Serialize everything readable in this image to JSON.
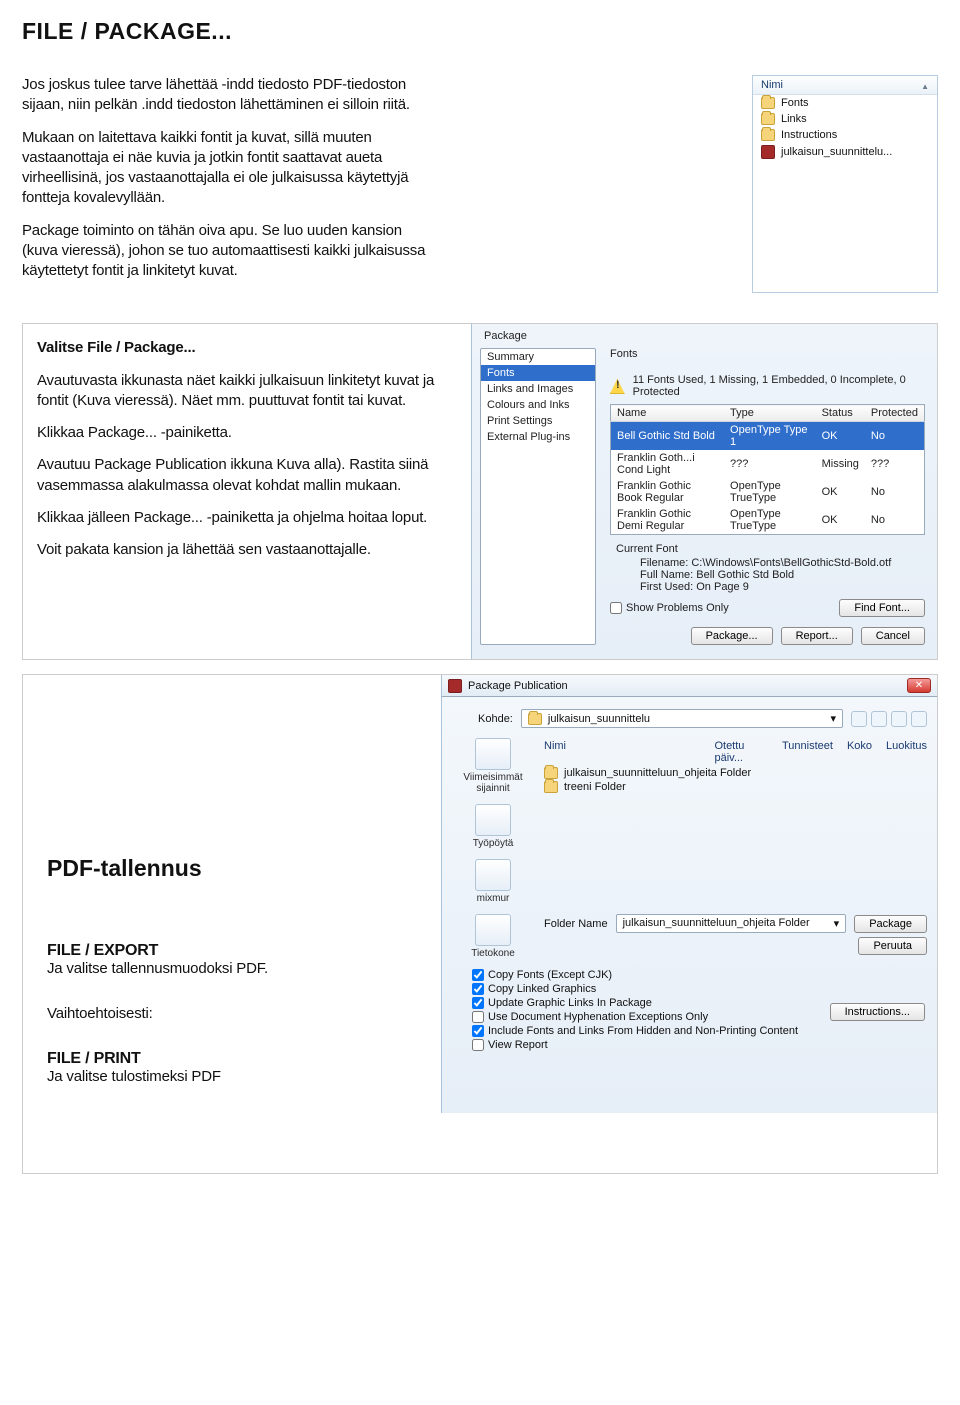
{
  "heading": "FILE / PACKAGE...",
  "intro": {
    "p1": "Jos joskus tulee tarve lähettää -indd tiedosto PDF-tiedoston sijaan, niin pelkän .indd tiedoston lähettäminen ei silloin riitä.",
    "p2": "Mukaan on laitettava kaikki fontit ja kuvat, sillä muuten vastaanottaja ei näe kuvia ja jotkin fontit saattavat aueta virheellisinä, jos vastaanottajalla ei ole julkaisussa käytettyjä fontteja kovalevyllään.",
    "p3": "Package toiminto on tähän oiva apu. Se luo uuden kansion (kuva vieressä), johon se tuo automaattisesti kaikki julkaisussa käytettetyt fontit ja linkitetyt kuvat."
  },
  "nimi_panel": {
    "header": "Nimi",
    "items": [
      "Fonts",
      "Links",
      "Instructions",
      "julkaisun_suunnittelu..."
    ]
  },
  "midleft": {
    "h": "Valitse File / Package...",
    "p1": "Avautuvasta ikkunasta näet kaikki julkaisuun linkitetyt kuvat ja fontit (Kuva vieressä). Näet mm. puuttuvat fontit tai kuvat.",
    "p2": "Klikkaa Package... -painiketta.",
    "p3": "Avautuu Package Publication ikkuna Kuva alla). Rastita siinä vasemmassa alakulmassa olevat kohdat mallin mukaan.",
    "p4": "Klikkaa jälleen Package... -painiketta ja ohjelma hoitaa loput.",
    "p5": "Voit pakata kansion ja lähettää sen vastaanottajalle."
  },
  "pkg_dialog": {
    "title": "Package",
    "side": [
      "Summary",
      "Fonts",
      "Links and Images",
      "Colours and Inks",
      "Print Settings",
      "External Plug-ins"
    ],
    "side_selected": 1,
    "right_title": "Fonts",
    "warn_text": "11 Fonts Used, 1 Missing, 1 Embedded, 0 Incomplete, 0 Protected",
    "columns": [
      "Name",
      "Type",
      "Status",
      "Protected"
    ],
    "rows": [
      {
        "name": "Bell Gothic Std Bold",
        "type": "OpenType Type 1",
        "status": "OK",
        "prot": "No",
        "sel": true
      },
      {
        "name": "Franklin Goth...i Cond Light",
        "type": "???",
        "status": "Missing",
        "prot": "???"
      },
      {
        "name": "Franklin Gothic Book Regular",
        "type": "OpenType TrueType",
        "status": "OK",
        "prot": "No"
      },
      {
        "name": "Franklin Gothic Demi Regular",
        "type": "OpenType TrueType",
        "status": "OK",
        "prot": "No"
      }
    ],
    "current_font_label": "Current Font",
    "meta": {
      "filename_label": "Filename:",
      "filename": "C:\\Windows\\Fonts\\BellGothicStd-Bold.otf",
      "fullname_label": "Full Name:",
      "fullname": "Bell Gothic Std Bold",
      "firstused_label": "First Used:",
      "firstused": "On Page 9"
    },
    "show_problems": "Show Problems Only",
    "btn_find": "Find Font...",
    "btn_pkg": "Package...",
    "btn_report": "Report...",
    "btn_cancel": "Cancel"
  },
  "ppub": {
    "title": "Package Publication",
    "kohde_label": "Kohde:",
    "kohde_value": "julkaisun_suunnittelu",
    "places": [
      "Viimeisimmät sijainnit",
      "Työpöytä",
      "mixmur",
      "Tietokone"
    ],
    "file_cols": [
      "Nimi",
      "Otettu päiv...",
      "Tunnisteet",
      "Koko",
      "Luokitus"
    ],
    "file_rows": [
      "julkaisun_suunnitteluun_ohjeita Folder",
      "treeni Folder"
    ],
    "folder_name_label": "Folder Name",
    "folder_name_value": "julkaisun_suunnitteluun_ohjeita Folder",
    "btn_package": "Package",
    "btn_peruuta": "Peruuta",
    "btn_instructions": "Instructions...",
    "checks": [
      {
        "label": "Copy Fonts (Except CJK)",
        "checked": true
      },
      {
        "label": "Copy Linked Graphics",
        "checked": true
      },
      {
        "label": "Update Graphic Links In Package",
        "checked": true
      },
      {
        "label": "Use Document Hyphenation Exceptions Only",
        "checked": false
      },
      {
        "label": "Include Fonts and Links From Hidden and Non-Printing Content",
        "checked": true
      },
      {
        "label": "View Report",
        "checked": false
      }
    ]
  },
  "low": {
    "h": "PDF-tallennus",
    "sec1_label": "FILE / EXPORT",
    "sec1_text": "Ja valitse tallennusmuodoksi PDF.",
    "sec2_label": "Vaihtoehtoisesti:",
    "sec3_label": "FILE / PRINT",
    "sec3_text": "Ja valitse tulostimeksi PDF"
  }
}
